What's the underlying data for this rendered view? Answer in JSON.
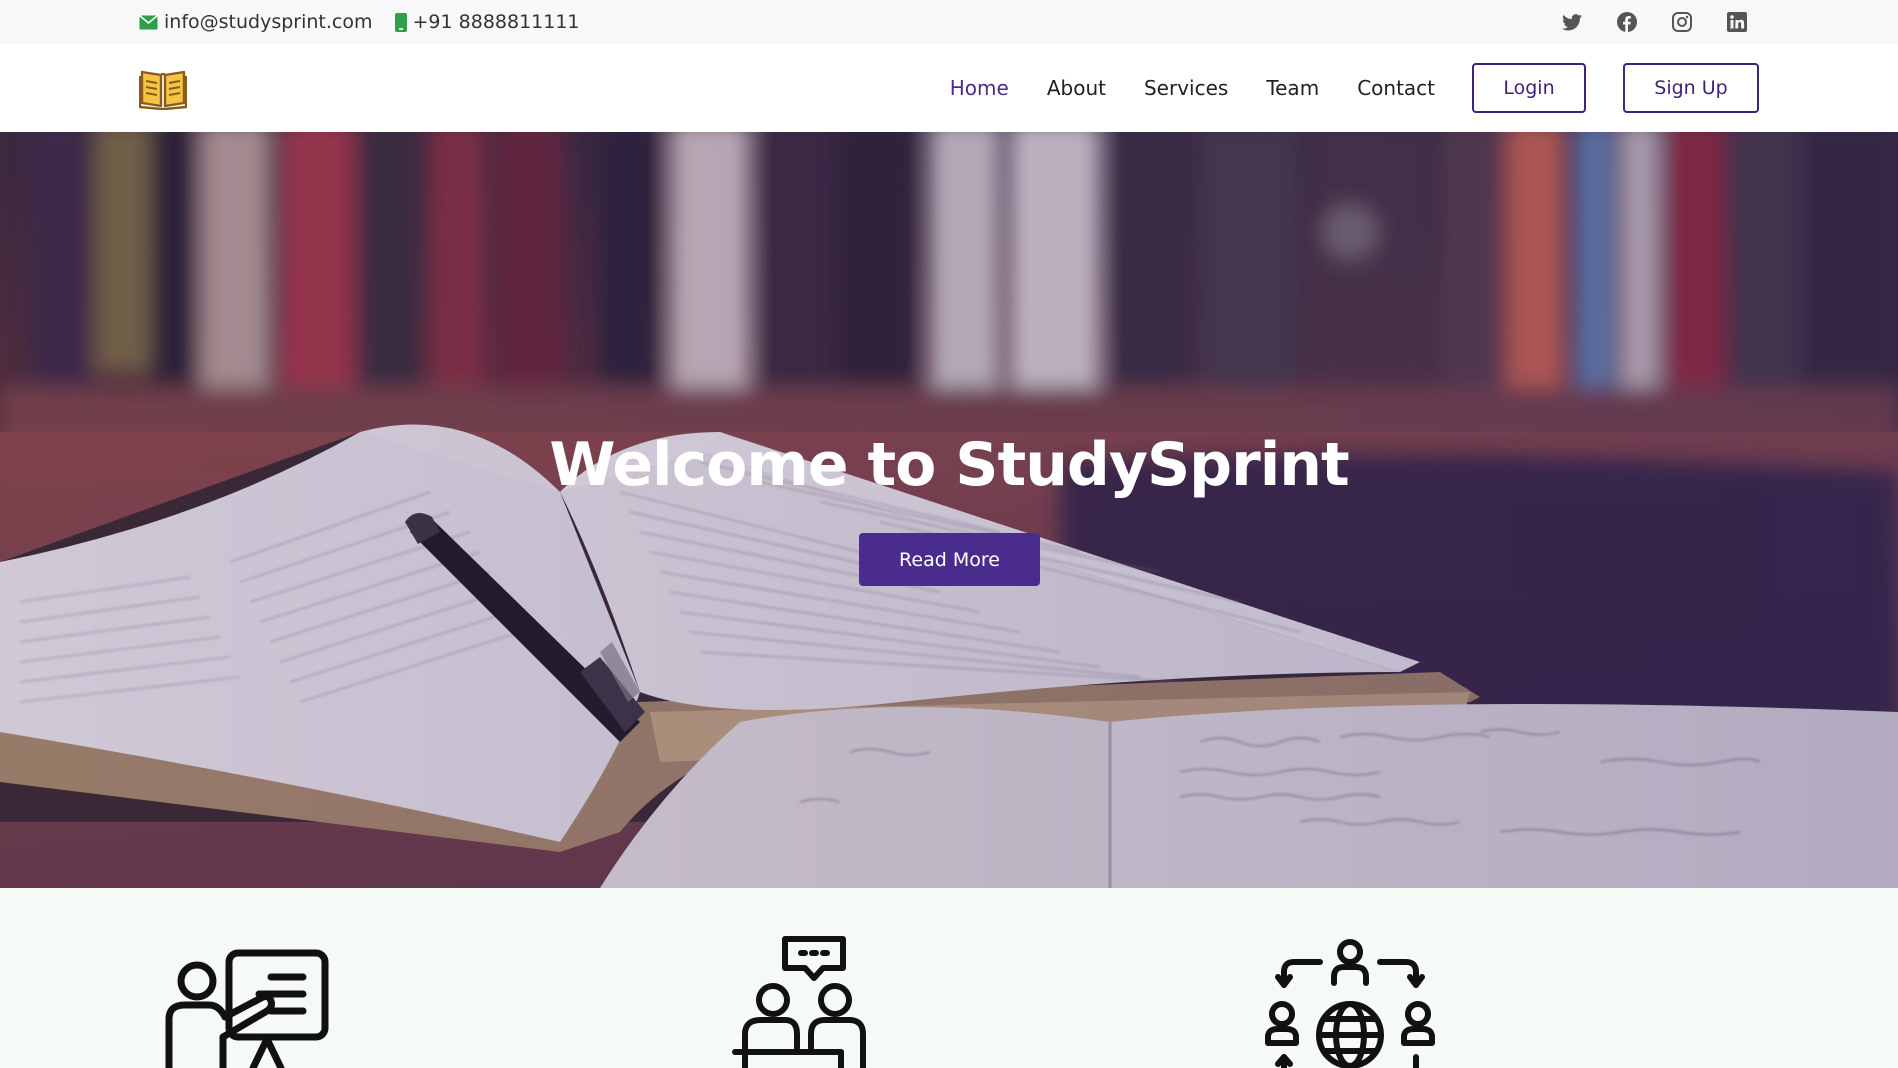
{
  "topbar": {
    "email": "info@studysprint.com",
    "phone": "+91 8888811111",
    "social": [
      "twitter-icon",
      "facebook-icon",
      "instagram-icon",
      "linkedin-icon"
    ]
  },
  "header": {
    "logo_icon": "open-book-icon",
    "nav": {
      "home": "Home",
      "about": "About",
      "services": "Services",
      "team": "Team",
      "contact": "Contact"
    },
    "login_label": "Login",
    "signup_label": "Sign Up"
  },
  "hero": {
    "title": "Welcome to StudySprint",
    "button_label": "Read More"
  },
  "features": {
    "icons": [
      "teacher-presentation-icon",
      "discussion-group-icon",
      "global-network-icon"
    ]
  },
  "colors": {
    "accent": "#4a2c8c",
    "topbar_bg": "#f8f8f8",
    "features_bg": "#f5faf7"
  }
}
